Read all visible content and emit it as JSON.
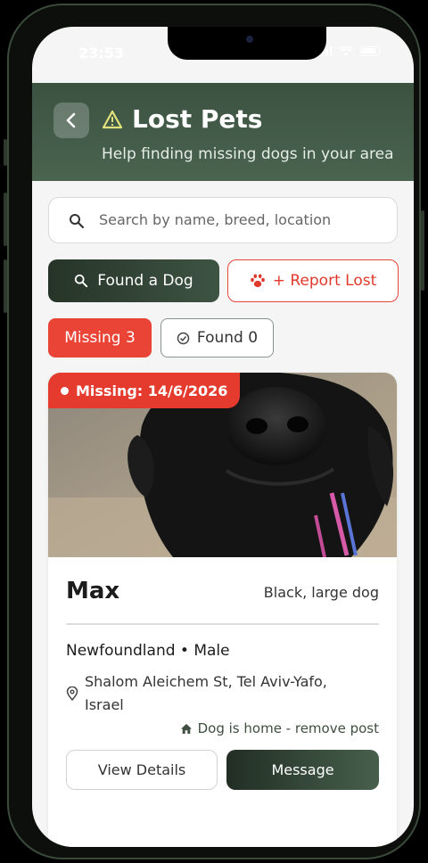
{
  "status_bar": {
    "time": "23:53"
  },
  "header": {
    "title": "Lost Pets",
    "subtitle": "Help finding missing dogs in your area"
  },
  "search": {
    "placeholder": "Search by name, breed, location"
  },
  "actions": {
    "found_label": "Found a Dog",
    "report_label": "+ Report Lost"
  },
  "tabs": [
    {
      "label": "Missing 3",
      "active": true
    },
    {
      "label": "Found 0",
      "active": false
    }
  ],
  "pet_card": {
    "badge": "Missing: 14/6/2026",
    "name": "Max",
    "description": "Black, large dog",
    "breed_sex": "Newfoundland • Male",
    "location": "Shalom Aleichem St, Tel Aviv-Yafo, Israel",
    "home_link": "Dog is home - remove post",
    "view_details_label": "View Details",
    "message_label": "Message"
  },
  "colors": {
    "header_green": "#3b5240",
    "accent_red": "#ea4436",
    "dark_green": "#263428"
  }
}
